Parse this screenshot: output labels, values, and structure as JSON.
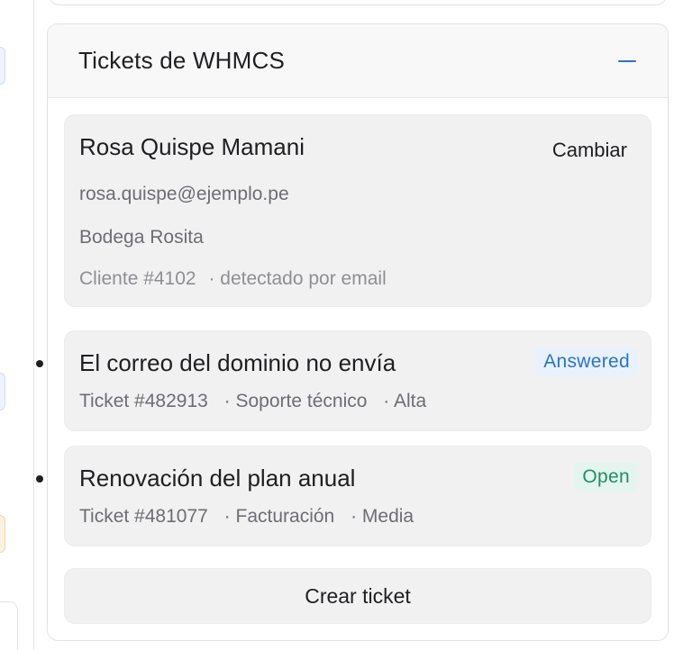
{
  "panel": {
    "title": "Tickets de WHMCS",
    "collapse_icon": "minus-icon",
    "accent_color": "#2a74c9"
  },
  "contact": {
    "name": "Rosa Quispe Mamani",
    "change_label": "Cambiar",
    "email": "rosa.quispe@ejemplo.pe",
    "company": "Bodega Rosita",
    "client_id": "Cliente #4102",
    "detection": "· detectado por email"
  },
  "tickets": [
    {
      "subject": "El correo del dominio no envía",
      "status": "Answered",
      "status_color": "#2a74c9",
      "number": "Ticket #482913",
      "department": "· Soporte técnico",
      "priority": "· Alta"
    },
    {
      "subject": "Renovación del plan anual",
      "status": "Open",
      "status_color": "#1f8f67",
      "number": "Ticket #481077",
      "department": "· Facturación",
      "priority": "· Media"
    }
  ],
  "actions": {
    "create_ticket_label": "Crear ticket"
  }
}
